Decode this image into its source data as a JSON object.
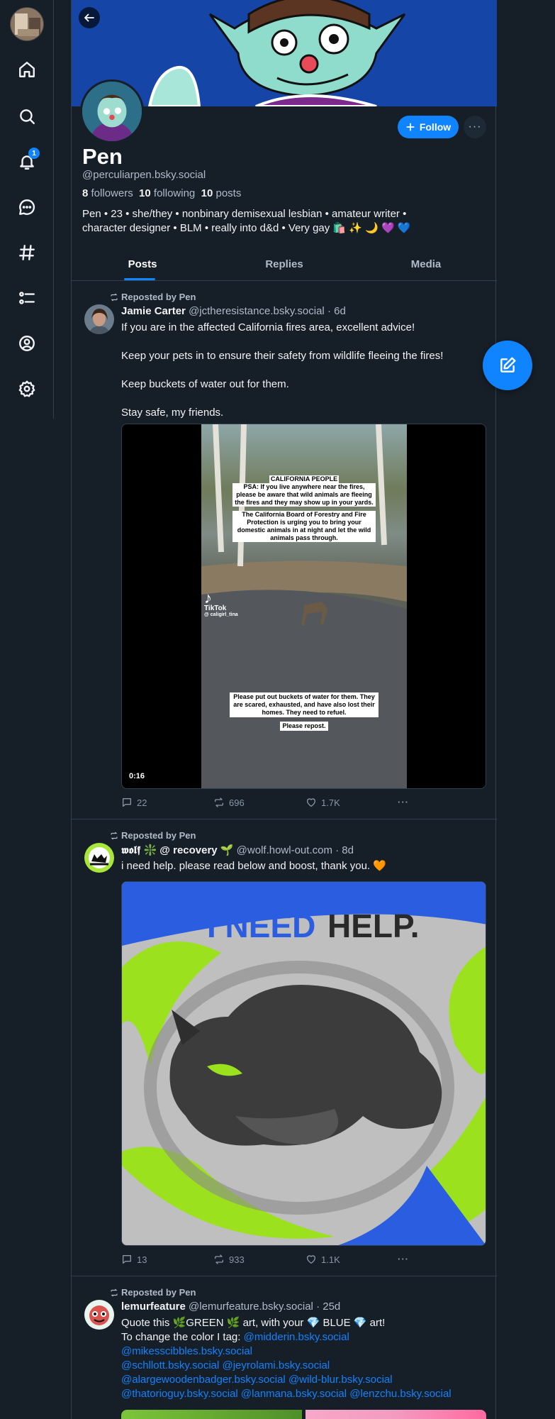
{
  "nav": {
    "items": [
      {
        "icon": "home-icon"
      },
      {
        "icon": "search-icon"
      },
      {
        "icon": "bell-icon",
        "badge": "1"
      },
      {
        "icon": "chat-icon"
      },
      {
        "icon": "hashtag-icon"
      },
      {
        "icon": "list-icon"
      },
      {
        "icon": "profile-icon"
      },
      {
        "icon": "gear-icon"
      }
    ]
  },
  "profile": {
    "name": "Pen",
    "handle": "@perculiarpen.bsky.social",
    "followers_count": "8",
    "followers_label": "followers",
    "following_count": "10",
    "following_label": "following",
    "posts_count": "10",
    "posts_label": "posts",
    "bio_line1": "Pen • 23 • she/they • nonbinary demisexual lesbian • amateur writer •",
    "bio_line2": "character designer • BLM • really into d&d • Very gay 🛍️ ✨ 🌙 💜 💙",
    "follow_label": "Follow",
    "more_label": "···"
  },
  "tabs": [
    "Posts",
    "Replies",
    "Media"
  ],
  "colors": {
    "accent": "#1083fe",
    "background": "#161e27",
    "border": "#2e4052"
  },
  "posts": [
    {
      "repost_label": "Reposted by Pen",
      "author": "Jamie Carter",
      "handle": "@jctheresistance.bsky.social",
      "time": "· 6d",
      "text": [
        "If you are in the affected California fires area, excellent advice!",
        "Keep your pets in to ensure their safety from wildlife fleeing the fires!",
        "Keep buckets of water out for them.",
        "Stay safe, my friends."
      ],
      "video": {
        "caption_title": "CALIFORNIA PEOPLE",
        "caption_1": "PSA: If you live anywhere near the fires, please be aware that wild animals are fleeing the fires and they may show up in your yards.",
        "caption_2": "The California Board of Forestry and Fire Protection is urging you to bring your domestic animals in at night and let the wild animals pass through.",
        "caption_3": "Please put out buckets of water for them. They are scared, exhausted, and have also lost their homes. They need to refuel.",
        "caption_4": "Please repost.",
        "tiktok_label": "TikTok",
        "tiktok_handle": "@ caligirl_tina",
        "duration": "0:16"
      },
      "replies": "22",
      "reposts": "696",
      "likes": "1.7K",
      "more": "···"
    },
    {
      "repost_label": "Reposted by Pen",
      "author": "𝖜𝖔𝖑𝖋 ❇️ @ recovery 🌱",
      "handle": "@wolf.howl-out.com",
      "time": "· 8d",
      "text": [
        "i need help. please read below and boost, thank you. 🧡"
      ],
      "image_title": "I NEED HELP.",
      "replies": "13",
      "reposts": "933",
      "likes": "1.1K",
      "more": "···"
    },
    {
      "repost_label": "Reposted by Pen",
      "author": "lemurfeature",
      "handle": "@lemurfeature.bsky.social",
      "time": "· 25d",
      "line1": "Quote this 🌿GREEN 🌿 art, with your 💎 BLUE 💎 art!",
      "line2_prefix": "To change the color I tag: ",
      "mention1": "@midderin.bsky.social",
      "mention2": "@mikesscibbles.bsky.social",
      "mention3": "@schllott.bsky.social",
      "mention4": "@jeyrolami.bsky.social",
      "mention5": "@alargewoodenbadger.bsky.social",
      "mention6": "@wild-blur.bsky.social",
      "mention7": "@thatorioguy.bsky.social",
      "mention8": "@lanmana.bsky.social",
      "mention9": "@lenzchu.bsky.social"
    }
  ]
}
